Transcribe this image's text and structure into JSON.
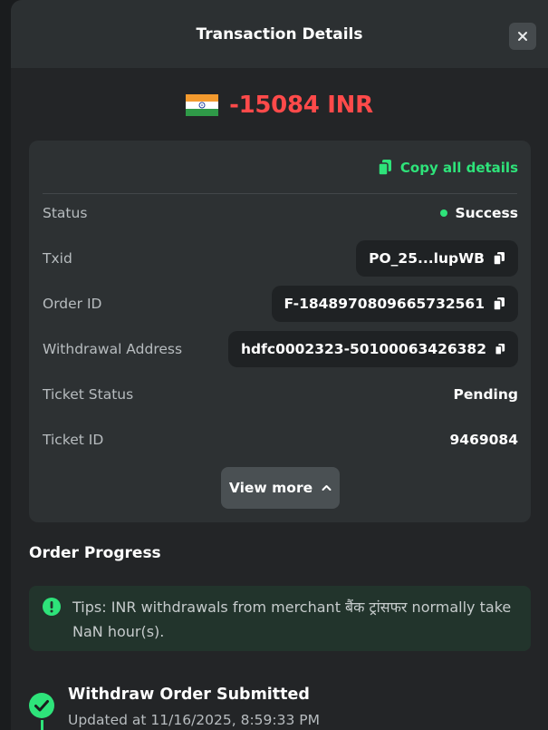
{
  "header": {
    "title": "Transaction Details",
    "close_icon": "close-icon"
  },
  "amount": {
    "flag_icon": "india-flag-icon",
    "value": "-15084 INR",
    "color": "#ff4a4a"
  },
  "details": {
    "copy_all_label": "Copy all details",
    "rows": {
      "status": {
        "label": "Status",
        "value": "Success"
      },
      "txid": {
        "label": "Txid",
        "value": "PO_25...lupWB"
      },
      "order_id": {
        "label": "Order ID",
        "value": "F-1848970809665732561"
      },
      "withdrawal_address": {
        "label": "Withdrawal Address",
        "value": "hdfc0002323-50100063426382"
      },
      "ticket_status": {
        "label": "Ticket Status",
        "value": "Pending"
      },
      "ticket_id": {
        "label": "Ticket ID",
        "value": "9469084"
      }
    },
    "view_more_label": "View more"
  },
  "order_progress": {
    "title": "Order Progress",
    "tips": "Tips: INR withdrawals from merchant बैंक ट्रांसफर normally take NaN hour(s).",
    "steps": [
      {
        "title": "Withdraw Order Submitted",
        "time": "Updated at 11/16/2025, 8:59:33 PM"
      }
    ]
  },
  "colors": {
    "accent_green": "#2ee37a",
    "negative_red": "#ff4a4a",
    "panel_bg": "#2d3133"
  }
}
